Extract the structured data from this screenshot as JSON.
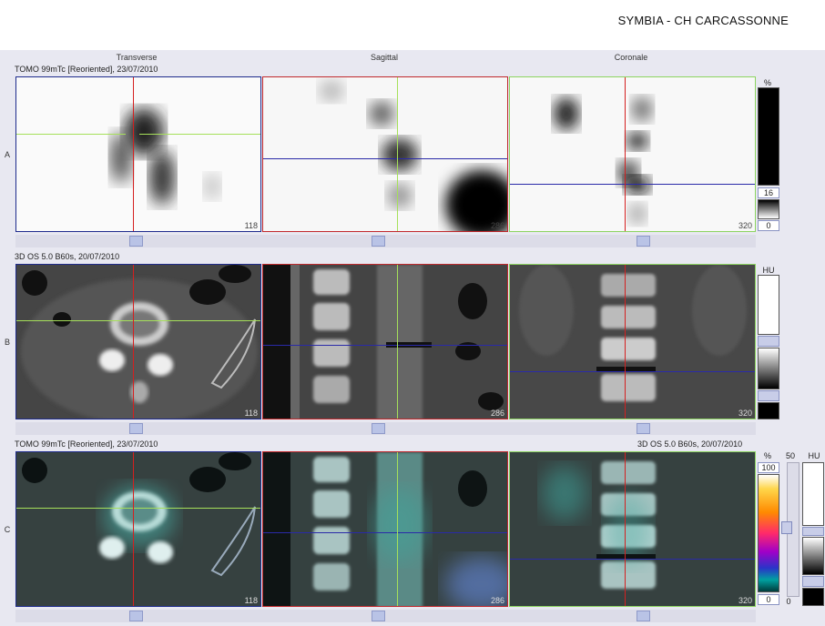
{
  "header": {
    "title": "SYMBIA - CH CARCASSONNE"
  },
  "columns": {
    "transverse": "Transverse",
    "sagittal": "Sagittal",
    "coronal": "Coronale"
  },
  "rows": {
    "a": {
      "label": "A",
      "series": "TOMO 99mTc [Reoriented], 23/07/2010"
    },
    "b": {
      "label": "B",
      "series": "3D  OS  5.0  B60s, 20/07/2010"
    },
    "c": {
      "label": "C",
      "series_left": "TOMO 99mTc [Reoriented], 23/07/2010",
      "series_right": "3D  OS  5.0  B60s, 20/07/2010"
    }
  },
  "slices": {
    "transverse": "118",
    "sagittal": "286",
    "coronal": "320"
  },
  "scales": {
    "a": {
      "unit": "%",
      "upper": "16",
      "lower": "0"
    },
    "b": {
      "unit": "HU"
    },
    "c": {
      "pct_unit": "%",
      "pct_top": "100",
      "pct_bottom": "0",
      "mid_value": "50",
      "hu_unit": "HU",
      "small_zero": "0"
    }
  },
  "colors": {
    "red": "#d42020",
    "green": "#a6e05a",
    "blue": "#2a2aa8",
    "frame_blue": "#1e2a8c",
    "frame_red": "#c0282c",
    "frame_green": "#8cd460"
  }
}
